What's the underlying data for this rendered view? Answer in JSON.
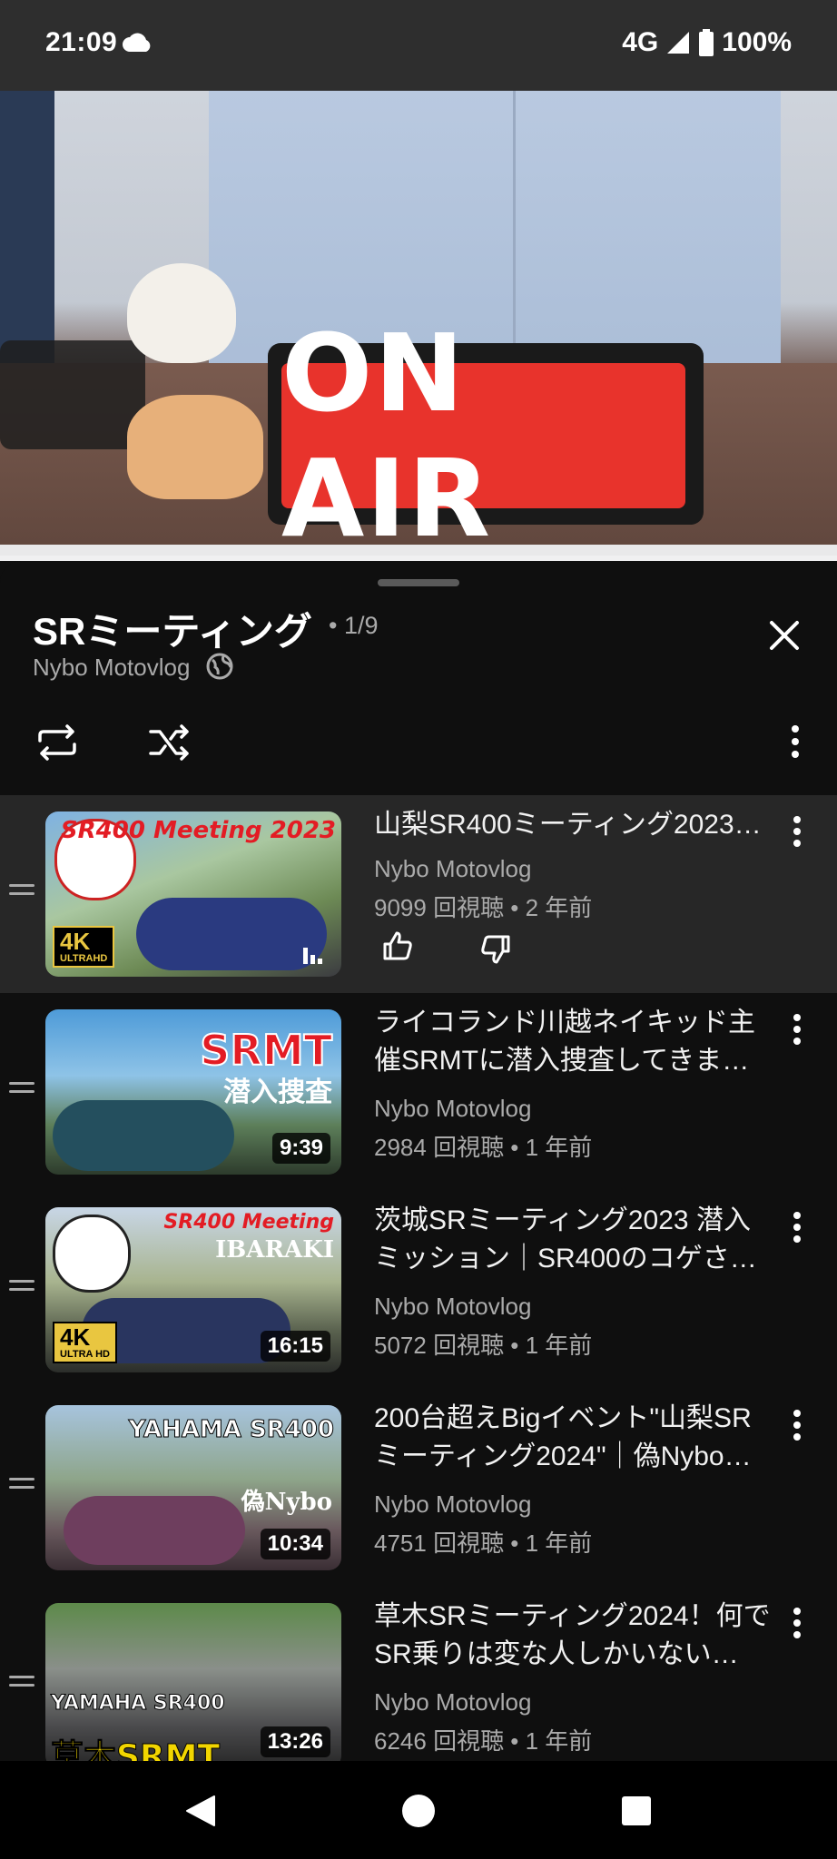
{
  "status": {
    "time": "21:09",
    "network": "4G",
    "battery": "100%"
  },
  "video": {
    "sign_text": "ON AIR"
  },
  "playlist": {
    "title": "SRミーティング",
    "index": "• 1/9",
    "channel": "Nybo Motovlog"
  },
  "items": [
    {
      "title": "山梨SR400ミーティング2023…",
      "channel": "Nybo Motovlog",
      "meta": "9099 回視聴 • 2 年前",
      "duration": "",
      "thumb_text": "SR400 Meeting 2023",
      "badge": "4K",
      "badge_sub": "ULTRAHD"
    },
    {
      "title": "ライコランド川越ネイキッド主催SRMTに潜入捜査してきま…",
      "channel": "Nybo Motovlog",
      "meta": "2984 回視聴 • 1 年前",
      "duration": "9:39",
      "thumb_text": "SRMT",
      "thumb_sub": "潜入捜査"
    },
    {
      "title": "茨城SRミーティング2023 潜入ミッション｜SR400のコゲさ…",
      "channel": "Nybo Motovlog",
      "meta": "5072 回視聴 • 1 年前",
      "duration": "16:15",
      "thumb_text": "SR400 Meeting",
      "thumb_sub": "IBARAKI",
      "badge": "4K",
      "badge_sub": "ULTRA HD"
    },
    {
      "title": "200台超えBigイベント\"山梨SRミーティング2024\"｜偽Nybo…",
      "channel": "Nybo Motovlog",
      "meta": "4751 回視聴 • 1 年前",
      "duration": "10:34",
      "thumb_text": "YAHAMA SR400",
      "thumb_sub": "偽Nybo"
    },
    {
      "title": "草木SRミーティング2024！何でSR乗りは変な人しかいない…",
      "channel": "Nybo Motovlog",
      "meta": "6246 回視聴 • 1 年前",
      "duration": "13:26",
      "thumb_text": "YAMAHA SR400",
      "thumb_sub": "草木SRMT"
    }
  ],
  "icons": {
    "close": "close-icon",
    "repeat": "repeat-icon",
    "shuffle": "shuffle-icon",
    "more": "more-vert-icon",
    "globe": "globe-icon",
    "like": "thumbs-up-icon",
    "dislike": "thumbs-down-icon",
    "nav_back": "back-icon",
    "nav_home": "home-icon",
    "nav_recent": "recents-icon"
  },
  "colors": {
    "background": "#0f0f0f",
    "active_row": "#272727",
    "secondary_text": "#aaaaaa",
    "sign_red": "#e8332c"
  }
}
